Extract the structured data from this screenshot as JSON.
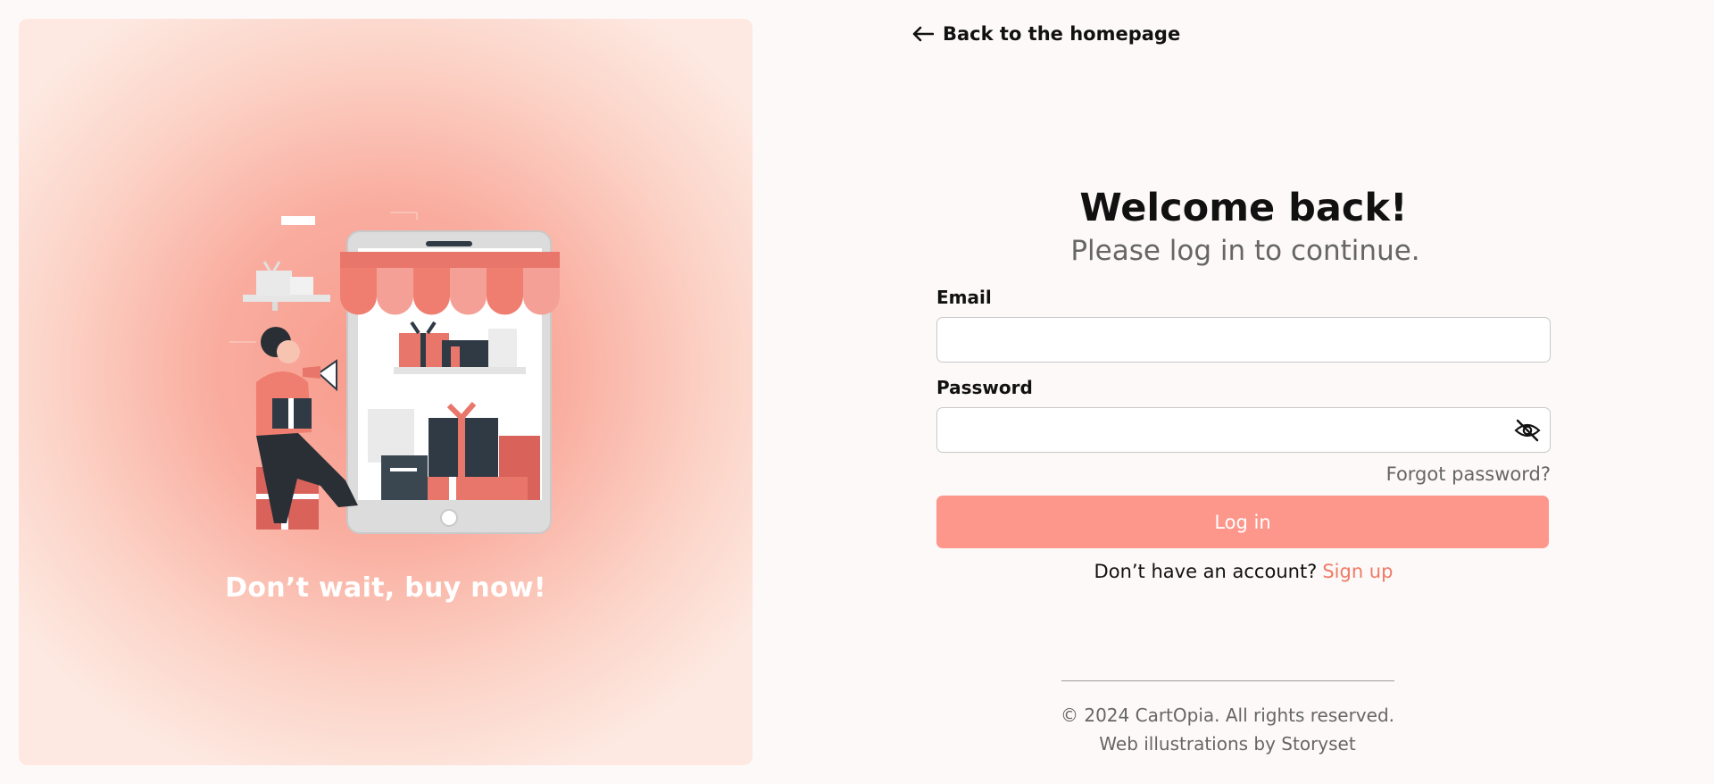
{
  "hero": {
    "tagline": "Don’t wait, buy now!",
    "illustration": "online-shop-illustration"
  },
  "nav": {
    "back_label": "Back to the homepage",
    "back_icon": "arrow-left-icon"
  },
  "form": {
    "title": "Welcome back!",
    "subtitle": "Please log in to continue.",
    "email_label": "Email",
    "email_value": "",
    "password_label": "Password",
    "password_value": "",
    "password_toggle_icon": "eye-slash-icon",
    "forgot_label": "Forgot password?",
    "submit_label": "Log in",
    "signup_prompt": "Don’t have an account?",
    "signup_link": "Sign up"
  },
  "footer": {
    "copyright": "© 2024 CartOpia. All rights reserved.",
    "credit": "Web illustrations by Storyset"
  },
  "colors": {
    "accent": "#fd978b",
    "link": "#ef7a66",
    "panel_center": "#f79a8c",
    "panel_edge": "#fde9e1",
    "background": "#fdf9f8"
  }
}
